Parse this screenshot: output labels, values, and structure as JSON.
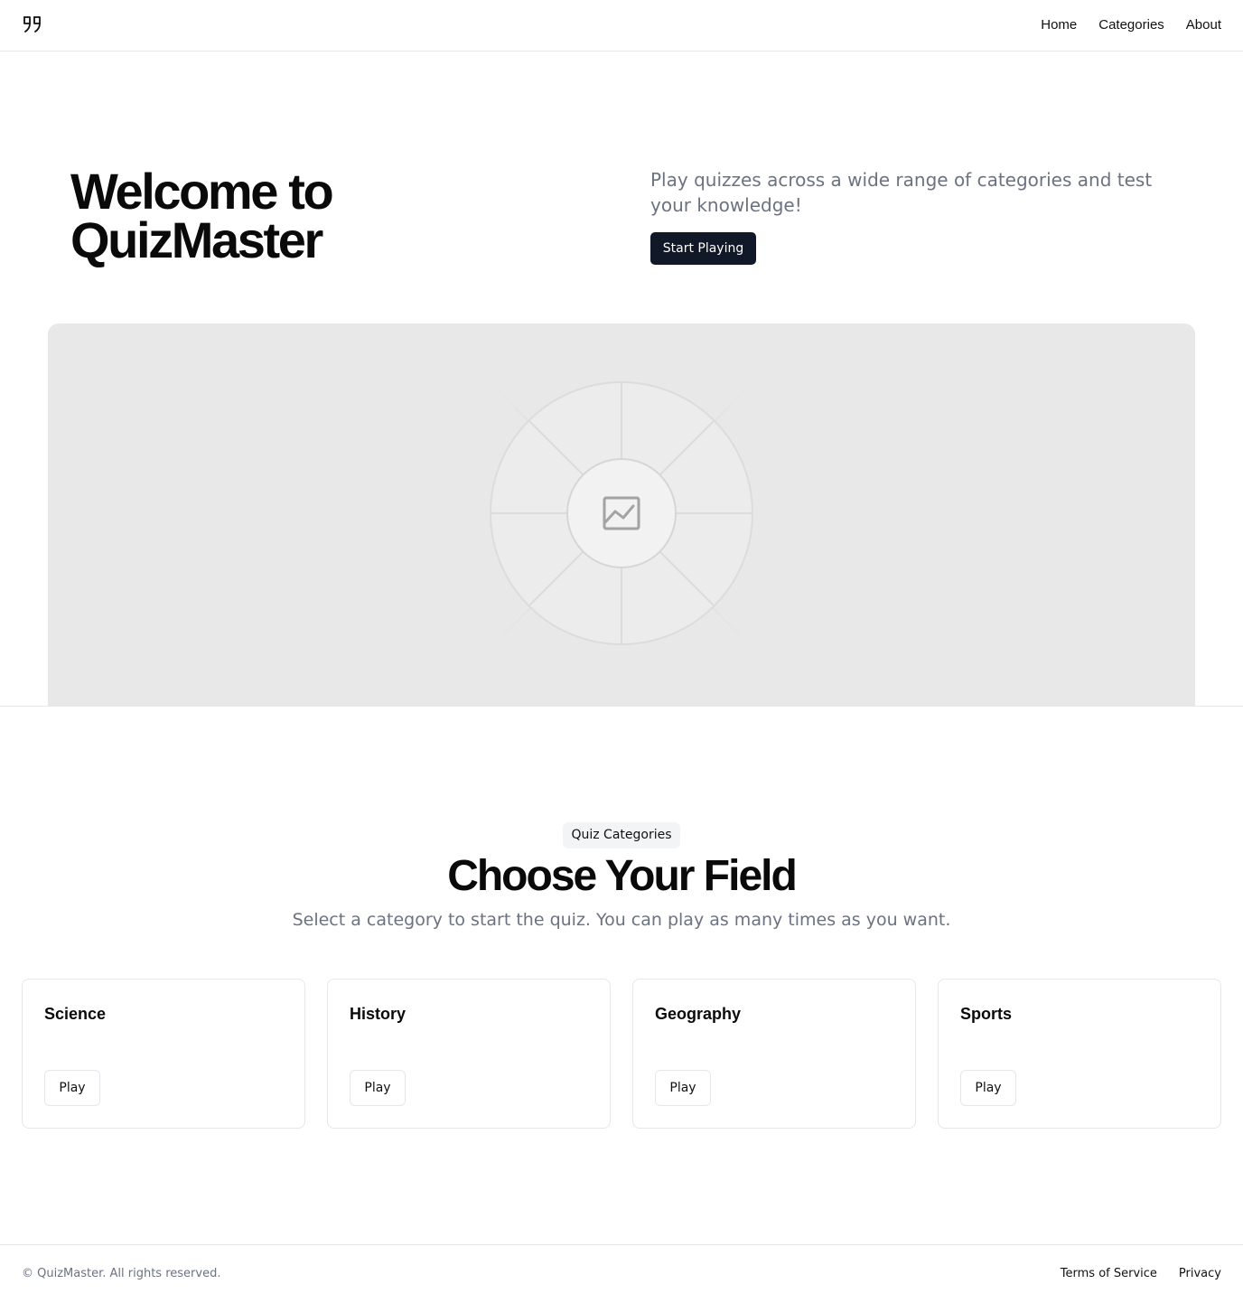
{
  "header": {
    "logo_icon": "quote-logo-icon",
    "nav": [
      {
        "label": "Home"
      },
      {
        "label": "Categories"
      },
      {
        "label": "About"
      }
    ]
  },
  "hero": {
    "title": "Welcome to QuizMaster",
    "description": "Play quizzes across a wide range of categories and test your knowledge!",
    "cta_label": "Start Playing",
    "image_icon": "image-placeholder-icon"
  },
  "categories": {
    "badge": "Quiz Categories",
    "title": "Choose Your Field",
    "subtitle": "Select a category to start the quiz. You can play as many times as you want.",
    "items": [
      {
        "name": "Science",
        "button": "Play"
      },
      {
        "name": "History",
        "button": "Play"
      },
      {
        "name": "Geography",
        "button": "Play"
      },
      {
        "name": "Sports",
        "button": "Play"
      }
    ]
  },
  "footer": {
    "copyright": "© QuizMaster. All rights reserved.",
    "links": [
      {
        "label": "Terms of Service"
      },
      {
        "label": "Privacy"
      }
    ]
  },
  "colors": {
    "primary_button": "#111827",
    "muted_text": "#6b7280",
    "border": "#e5e7eb",
    "placeholder_bg": "#e8e8e8"
  }
}
